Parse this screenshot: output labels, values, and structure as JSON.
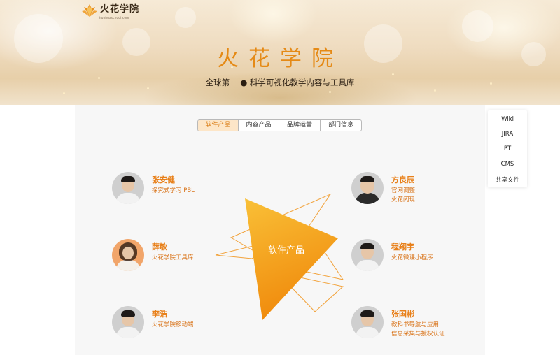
{
  "brand": {
    "logo_text": "火花学院",
    "logo_subtext": "huohuaschool.com"
  },
  "hero": {
    "title": "火花学院",
    "subtitle": "全球第一 ● 科学可视化教学内容与工具库"
  },
  "tabs": [
    {
      "label": "软件产品",
      "active": true
    },
    {
      "label": "内容产品",
      "active": false
    },
    {
      "label": "品牌运营",
      "active": false
    },
    {
      "label": "部门信息",
      "active": false
    }
  ],
  "side_menu": [
    {
      "label": "Wiki"
    },
    {
      "label": "JIRA"
    },
    {
      "label": "PT"
    },
    {
      "label": "CMS"
    },
    {
      "label": "共享文件"
    }
  ],
  "center": {
    "label": "软件产品"
  },
  "people_left": [
    {
      "name": "张安健",
      "lines": [
        "探究式学习 PBL"
      ]
    },
    {
      "name": "薛敏",
      "lines": [
        "火花学院工具库"
      ]
    },
    {
      "name": "李浩",
      "lines": [
        "火花学院移动端"
      ]
    }
  ],
  "people_right": [
    {
      "name": "方良辰",
      "lines": [
        "官网调整",
        "火花闪现"
      ]
    },
    {
      "name": "程翔宇",
      "lines": [
        "火花微课小程序"
      ]
    },
    {
      "name": "张国彬",
      "lines": [
        "教科书导航与应用",
        "信息采集与授权认证"
      ]
    }
  ],
  "colors": {
    "accent": "#e8801a",
    "tab_active_bg": "#fde6c8",
    "triangle_top": "#f9c037",
    "triangle_bottom": "#f08a0c"
  }
}
